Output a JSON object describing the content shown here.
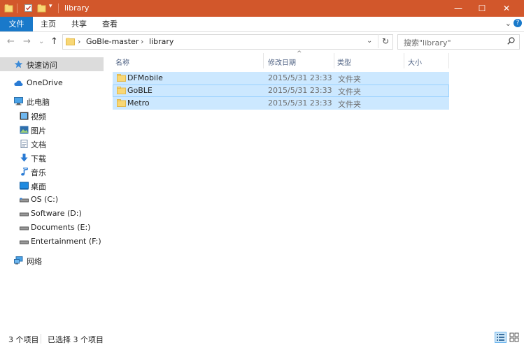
{
  "window": {
    "title": "library",
    "controls": [
      "—",
      "☐",
      "✕"
    ]
  },
  "ribbon": {
    "tabs": [
      {
        "label": "文件"
      },
      {
        "label": "主页"
      },
      {
        "label": "共享"
      },
      {
        "label": "查看"
      }
    ],
    "expand": "⌄",
    "help": "?"
  },
  "nav_buttons": {
    "back": "←",
    "forward": "→",
    "recent": "⌄",
    "up": "↑"
  },
  "address": {
    "segments": [
      "GoBle-master",
      "library"
    ],
    "separator": "›",
    "dropdown": "⌄",
    "refresh": "↻"
  },
  "search": {
    "placeholder": "搜索\"library\""
  },
  "nav_pane": {
    "items": [
      {
        "label": "快速访问",
        "icon": "star-icon",
        "selected": true
      },
      {
        "label": "OneDrive",
        "icon": "cloud-icon"
      },
      {
        "label": "此电脑",
        "icon": "computer-icon"
      },
      {
        "label": "视频",
        "icon": "video-icon"
      },
      {
        "label": "图片",
        "icon": "pictures-icon"
      },
      {
        "label": "文档",
        "icon": "documents-icon"
      },
      {
        "label": "下载",
        "icon": "download-icon"
      },
      {
        "label": "音乐",
        "icon": "music-icon"
      },
      {
        "label": "桌面",
        "icon": "desktop-icon"
      },
      {
        "label": "OS (C:)",
        "icon": "drive-icon"
      },
      {
        "label": "Software (D:)",
        "icon": "drive-icon"
      },
      {
        "label": "Documents (E:)",
        "icon": "drive-icon"
      },
      {
        "label": "Entertainment (F:)",
        "icon": "drive-icon"
      },
      {
        "label": "网络",
        "icon": "network-icon"
      }
    ]
  },
  "file_list": {
    "columns": [
      "名称",
      "修改日期",
      "类型",
      "大小"
    ],
    "sort_indicator": "^",
    "rows": [
      {
        "name": "DFMobile",
        "date": "2015/5/31 23:33",
        "type": "文件夹"
      },
      {
        "name": "GoBLE",
        "date": "2015/5/31 23:33",
        "type": "文件夹"
      },
      {
        "name": "Metro",
        "date": "2015/5/31 23:33",
        "type": "文件夹"
      }
    ]
  },
  "status": {
    "count": "3 个项目",
    "selected": "已选择 3 个项目"
  },
  "colors": {
    "titlebar": "#d2572b",
    "file_tab": "#1979ca",
    "selection": "#cce8ff",
    "folder": "#f8d775"
  }
}
